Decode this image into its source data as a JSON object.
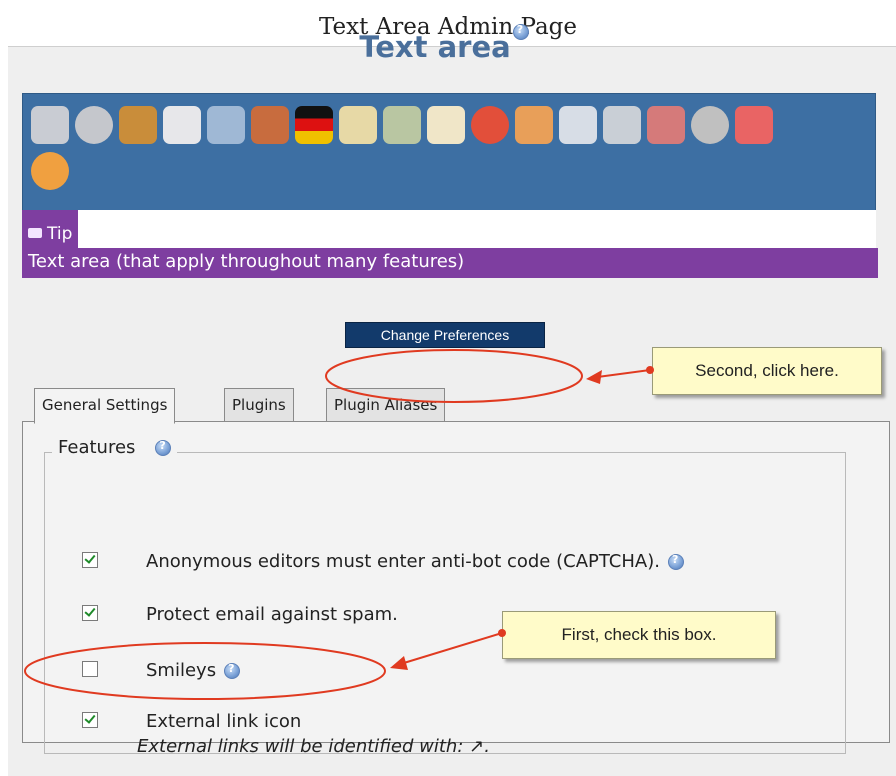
{
  "caption": "Text Area Admin Page",
  "header": {
    "title": "Text area"
  },
  "toolbar": {
    "icons": [
      {
        "name": "admin-tools-icon",
        "color": "#c9ccd3"
      },
      {
        "name": "power-icon",
        "color": "#c5c7cc"
      },
      {
        "name": "door-exit-icon",
        "color": "#c98d3a"
      },
      {
        "name": "hourglass-icon",
        "color": "#e7e7ea"
      },
      {
        "name": "picture-frame-icon",
        "color": "#9fb8d5"
      },
      {
        "name": "window-icon",
        "color": "#c86c3e"
      },
      {
        "name": "german-flag-icon",
        "color": "#e2b214"
      },
      {
        "name": "notepad-icon",
        "color": "#e7d9a6"
      },
      {
        "name": "map-icon",
        "color": "#b9c6a2"
      },
      {
        "name": "mail-icon",
        "color": "#f0e6c8"
      },
      {
        "name": "globe-icon",
        "color": "#e24f3a"
      },
      {
        "name": "users-icon",
        "color": "#e89f59"
      },
      {
        "name": "document-icon",
        "color": "#d7dde6"
      },
      {
        "name": "database-icon",
        "color": "#c9cfd6"
      },
      {
        "name": "plugins-icon",
        "color": "#d57a7a"
      },
      {
        "name": "brain-icon",
        "color": "#c0c0c0"
      },
      {
        "name": "spin-icon",
        "color": "#e96464"
      },
      {
        "name": "arrow-right-icon",
        "color": "#f0a040"
      }
    ]
  },
  "tip": {
    "label": "Tip",
    "text": "Text area (that apply throughout many features)"
  },
  "change_preferences": "Change Preferences",
  "callouts": {
    "second": "Second, click here.",
    "first": "First, check this box."
  },
  "tabs": [
    "General Settings",
    "Plugins",
    "Plugin Aliases"
  ],
  "features": {
    "legend": "Features",
    "items": [
      {
        "label": "Anonymous editors must enter anti-bot code (CAPTCHA).",
        "checked": true
      },
      {
        "label": "Protect email against spam.",
        "checked": true
      },
      {
        "label": "Smileys",
        "checked": false
      },
      {
        "label": "External link icon",
        "checked": true
      }
    ],
    "note": "External links will be identified with: ↗."
  },
  "colors": {
    "title": "#4a6f9b",
    "toolbar": "#3d6fa3",
    "tip": "#7e3ea0",
    "button": "#123a6b",
    "annotation": "#e03a20"
  }
}
